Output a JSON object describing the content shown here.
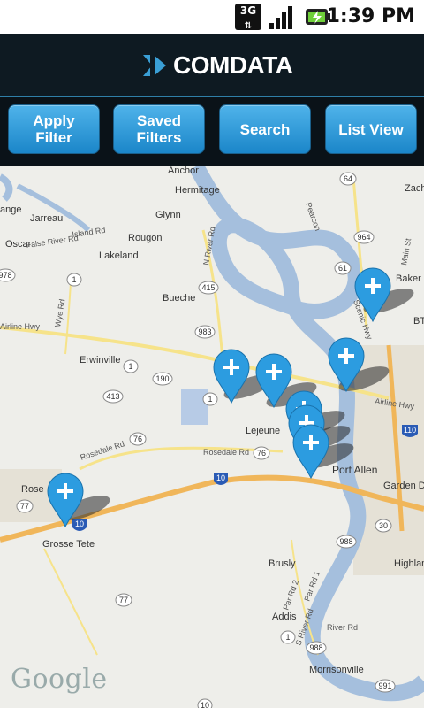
{
  "status_bar": {
    "time": "1:39 PM",
    "network": "3G",
    "icons": [
      "3g-icon",
      "signal-icon",
      "battery-charging-icon"
    ]
  },
  "header": {
    "brand": "COMDATA"
  },
  "toolbar": {
    "apply_filter": "Apply Filter",
    "saved_filters": "Saved Filters",
    "search": "Search",
    "list_view": "List View"
  },
  "map": {
    "places": [
      "Anchor",
      "Hermitage",
      "Zach",
      "Glynn",
      "Jarreau",
      "Oscar",
      "Rougon",
      "Lakeland",
      "Baker",
      "Bueche",
      "Erwinville",
      "Lejeune",
      "Port Allen",
      "Garden District",
      "Rosedale",
      "Grosse Tete",
      "Brusly",
      "Addis",
      "Morrisonville",
      "Highland Perkins",
      "ange",
      "Rose",
      "BTR"
    ],
    "roads": [
      "Island Rd",
      "False River Rd",
      "Airline Hwy",
      "Rosedale Rd",
      "Rosedale Rd",
      "Wye Rd",
      "N River Rd",
      "Airline Hwy",
      "Scenic Hwy",
      "Main St",
      "S River Rd",
      "River Rd",
      "Par Rd 1",
      "Par Rd 2",
      "Pearson"
    ],
    "route_shields": [
      "64",
      "964",
      "61",
      "978",
      "1",
      "415",
      "983",
      "1",
      "190",
      "413",
      "1",
      "76",
      "76",
      "10",
      "77",
      "10",
      "110",
      "30",
      "988",
      "1",
      "77",
      "988",
      "991",
      "10"
    ],
    "attribution": "Google",
    "pins_count": 9
  }
}
